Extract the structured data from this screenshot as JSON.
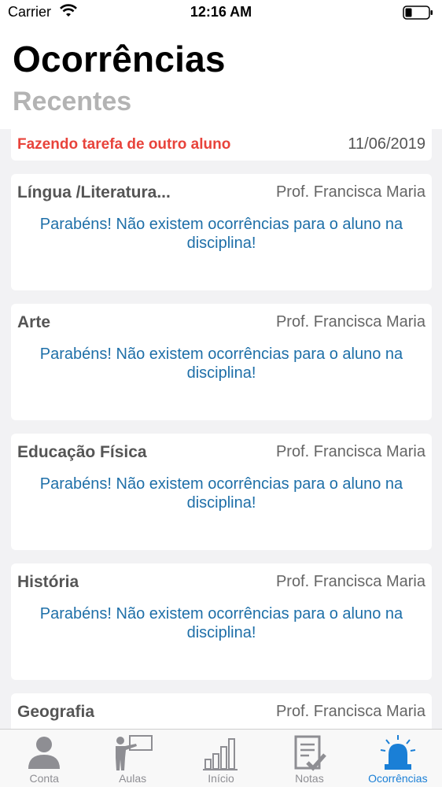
{
  "status_bar": {
    "carrier": "Carrier",
    "time": "12:16 AM"
  },
  "header": {
    "title": "Ocorrências",
    "subtitle": "Recentes"
  },
  "recent": {
    "title": "Fazendo tarefa de outro aluno",
    "date": "11/06/2019"
  },
  "cards": [
    {
      "subject": "Língua /Literatura...",
      "teacher": "Prof. Francisca Maria",
      "message": "Parabéns! Não existem ocorrências para o aluno na disciplina!"
    },
    {
      "subject": "Arte",
      "teacher": "Prof. Francisca Maria",
      "message": "Parabéns! Não existem ocorrências para o aluno na disciplina!"
    },
    {
      "subject": "Educação Física",
      "teacher": "Prof. Francisca Maria",
      "message": "Parabéns! Não existem ocorrências para o aluno na disciplina!"
    },
    {
      "subject": "História",
      "teacher": "Prof. Francisca Maria",
      "message": "Parabéns! Não existem ocorrências para o aluno na disciplina!"
    },
    {
      "subject": "Geografia",
      "teacher": "Prof. Francisca Maria",
      "message": ""
    }
  ],
  "tabs": [
    {
      "label": "Conta",
      "icon": "person-icon",
      "active": false
    },
    {
      "label": "Aulas",
      "icon": "teacher-board-icon",
      "active": false
    },
    {
      "label": "Início",
      "icon": "bar-chart-icon",
      "active": false
    },
    {
      "label": "Notas",
      "icon": "notes-check-icon",
      "active": false
    },
    {
      "label": "Ocorrências",
      "icon": "siren-icon",
      "active": true
    }
  ],
  "colors": {
    "accent": "#1a7fd6",
    "alert": "#e8433b",
    "message": "#1e6fa8",
    "inactive": "#8e8e93"
  }
}
